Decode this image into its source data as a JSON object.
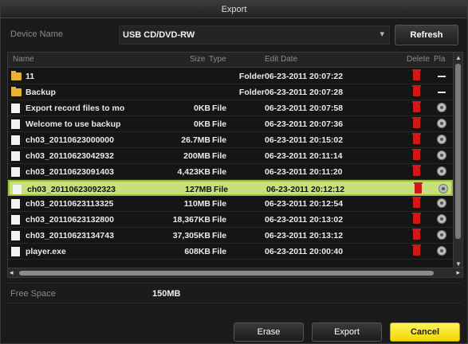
{
  "window": {
    "title": "Export"
  },
  "device": {
    "label": "Device Name",
    "value": "USB CD/DVD-RW",
    "refresh_label": "Refresh"
  },
  "table": {
    "headers": {
      "name": "Name",
      "size": "Size",
      "type": "Type",
      "date": "Edit Date",
      "delete": "Delete",
      "play": "Pla"
    },
    "rows": [
      {
        "name": "11",
        "size": "",
        "type": "Folder",
        "date": "06-23-2011 20:07:22",
        "kind": "folder",
        "selected": false
      },
      {
        "name": "Backup",
        "size": "",
        "type": "Folder",
        "date": "06-23-2011 20:07:28",
        "kind": "folder",
        "selected": false
      },
      {
        "name": "Export record files to mo",
        "size": "0KB",
        "type": "File",
        "date": "06-23-2011 20:07:58",
        "kind": "file",
        "selected": false
      },
      {
        "name": "Welcome to use backup",
        "size": "0KB",
        "type": "File",
        "date": "06-23-2011 20:07:36",
        "kind": "file",
        "selected": false
      },
      {
        "name": "ch03_20110623000000",
        "size": "26.7MB",
        "type": "File",
        "date": "06-23-2011 20:15:02",
        "kind": "file",
        "selected": false
      },
      {
        "name": "ch03_20110623042932",
        "size": "200MB",
        "type": "File",
        "date": "06-23-2011 20:11:14",
        "kind": "file",
        "selected": false
      },
      {
        "name": "ch03_20110623091403",
        "size": "4,423KB",
        "type": "File",
        "date": "06-23-2011 20:11:20",
        "kind": "file",
        "selected": false
      },
      {
        "name": "ch03_20110623092323",
        "size": "127MB",
        "type": "File",
        "date": "06-23-2011 20:12:12",
        "kind": "file",
        "selected": true
      },
      {
        "name": "ch03_20110623113325",
        "size": "110MB",
        "type": "File",
        "date": "06-23-2011 20:12:54",
        "kind": "file",
        "selected": false
      },
      {
        "name": "ch03_20110623132800",
        "size": "18,367KB",
        "type": "File",
        "date": "06-23-2011 20:13:02",
        "kind": "file",
        "selected": false
      },
      {
        "name": "ch03_20110623134743",
        "size": "37,305KB",
        "type": "File",
        "date": "06-23-2011 20:13:12",
        "kind": "file",
        "selected": false
      },
      {
        "name": "player.exe",
        "size": "608KB",
        "type": "File",
        "date": "06-23-2011 20:00:40",
        "kind": "file",
        "selected": false
      }
    ]
  },
  "free_space": {
    "label": "Free Space",
    "value": "150MB"
  },
  "buttons": {
    "erase": "Erase",
    "export": "Export",
    "cancel": "Cancel"
  },
  "icons": {
    "folder": "folder-icon",
    "file": "file-icon",
    "delete": "trash-icon",
    "play": "play-icon",
    "dropdown": "chevron-down-icon"
  },
  "colors": {
    "selected_row": "#c7e07a",
    "cancel_button": "#f7e400",
    "delete_icon": "#d01818",
    "folder_icon": "#e9b231"
  }
}
